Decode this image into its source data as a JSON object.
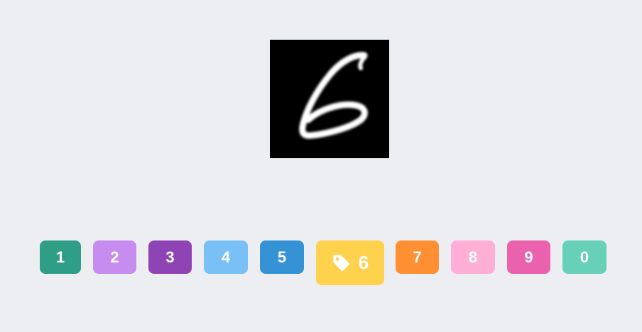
{
  "image": {
    "alt": "handwritten digit"
  },
  "labels": [
    {
      "key": "1",
      "label": "1",
      "color": "#2e9e86",
      "selected": false
    },
    {
      "key": "2",
      "label": "2",
      "color": "#c78cf0",
      "selected": false
    },
    {
      "key": "3",
      "label": "3",
      "color": "#8e44b5",
      "selected": false
    },
    {
      "key": "4",
      "label": "4",
      "color": "#78c0f5",
      "selected": false
    },
    {
      "key": "5",
      "label": "5",
      "color": "#3592d4",
      "selected": false
    },
    {
      "key": "6",
      "label": "6",
      "color": "#ffd24d",
      "selected": true,
      "icon": "tag-icon"
    },
    {
      "key": "7",
      "label": "7",
      "color": "#ff8f33",
      "selected": false
    },
    {
      "key": "8",
      "label": "8",
      "color": "#ffaed6",
      "selected": false
    },
    {
      "key": "9",
      "label": "9",
      "color": "#ea62ae",
      "selected": false
    },
    {
      "key": "0",
      "label": "0",
      "color": "#66d0b8",
      "selected": false
    }
  ]
}
